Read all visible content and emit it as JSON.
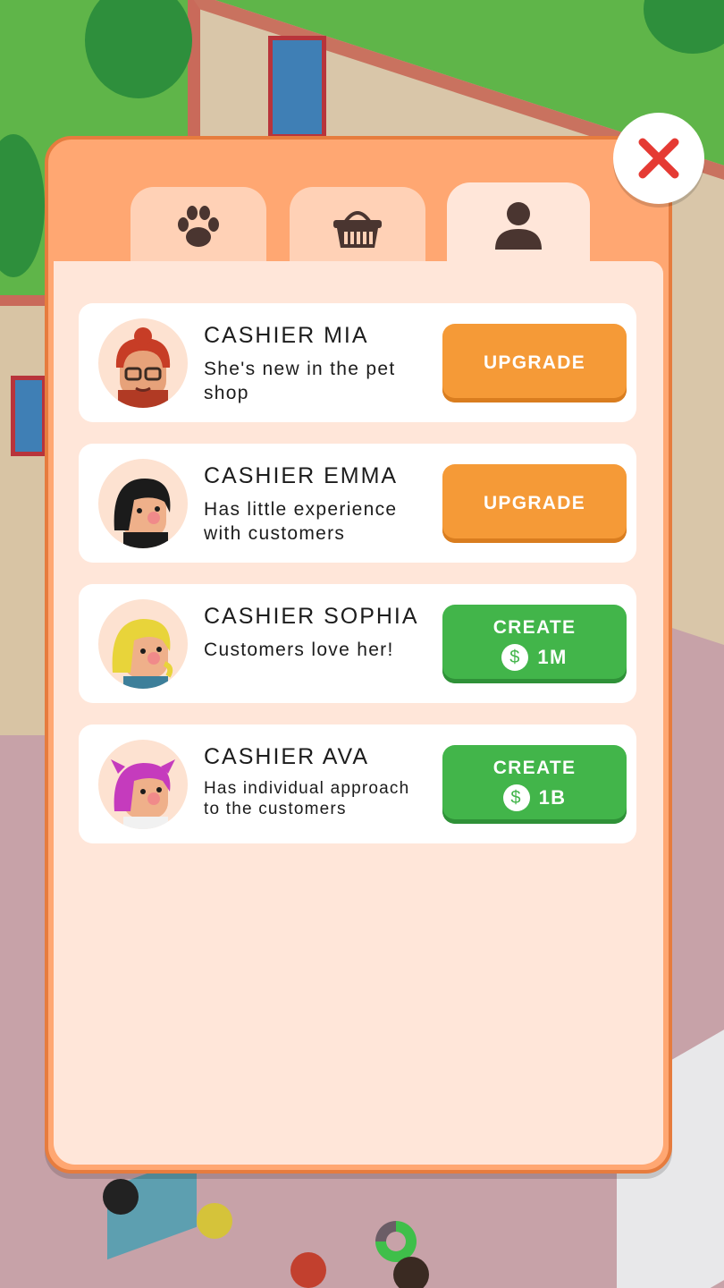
{
  "tabs": [
    {
      "name": "pets",
      "icon": "paw-icon"
    },
    {
      "name": "shop",
      "icon": "basket-icon"
    },
    {
      "name": "staff",
      "icon": "person-icon",
      "active": true
    }
  ],
  "close_icon": "close-icon",
  "staff": [
    {
      "title": "CASHIER MIA",
      "description": "She's new in the pet shop",
      "button_label": "UPGRADE",
      "button_type": "upgrade",
      "hair": "#c73d26"
    },
    {
      "title": "CASHIER EMMA",
      "description": "Has little experience with customers",
      "button_label": "UPGRADE",
      "button_type": "upgrade",
      "hair": "#1b1b1b"
    },
    {
      "title": "CASHIER SOPHIA",
      "description": "Customers love her!",
      "button_label": "CREATE",
      "button_type": "create",
      "price": "1M",
      "hair": "#e8d43a"
    },
    {
      "title": "CASHIER AVA",
      "description": "Has individual approach to the customers",
      "button_label": "CREATE",
      "button_type": "create",
      "price": "1B",
      "hair": "#c53bbd"
    }
  ],
  "colors": {
    "upgrade_button": "#f59a37",
    "create_button": "#42b54a",
    "panel": "#ffa772",
    "panel_inner": "#ffe6d9",
    "close_x": "#e53a33"
  },
  "currency_icon": "dollar-coin-icon"
}
